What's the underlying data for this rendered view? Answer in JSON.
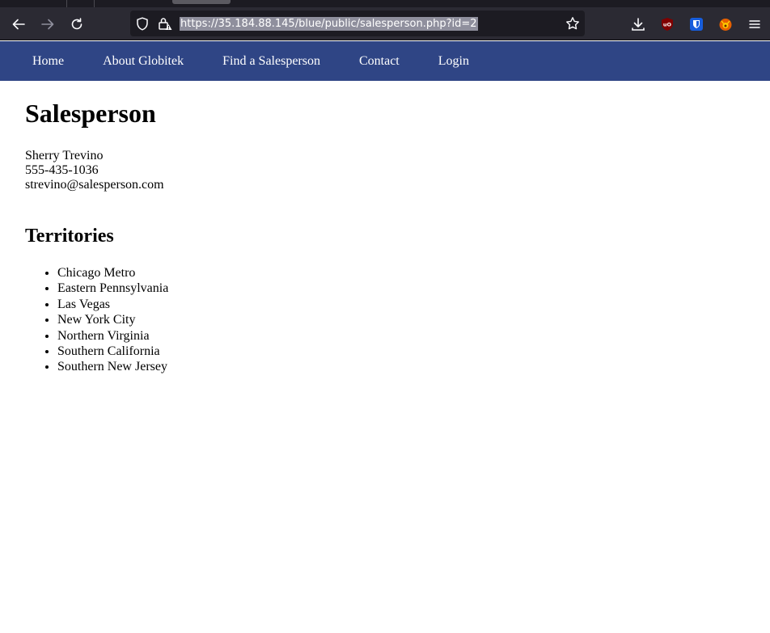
{
  "browser": {
    "url": "https://35.184.88.145/blue/public/salesperson.php?id=2"
  },
  "nav": {
    "items": [
      {
        "label": "Home"
      },
      {
        "label": "About Globitek"
      },
      {
        "label": "Find a Salesperson"
      },
      {
        "label": "Contact"
      },
      {
        "label": "Login"
      }
    ]
  },
  "page": {
    "title": "Salesperson",
    "name": "Sherry Trevino",
    "phone": "555-435-1036",
    "email": "strevino@salesperson.com",
    "territories_heading": "Territories",
    "territories": [
      "Chicago Metro",
      "Eastern Pennsylvania",
      "Las Vegas",
      "New York City",
      "Northern Virginia",
      "Southern California",
      "Southern New Jersey"
    ]
  },
  "colors": {
    "nav_bg": "#2f4585",
    "toolbar_bg": "#2b2a33",
    "urlbar_bg": "#1c1b22"
  }
}
